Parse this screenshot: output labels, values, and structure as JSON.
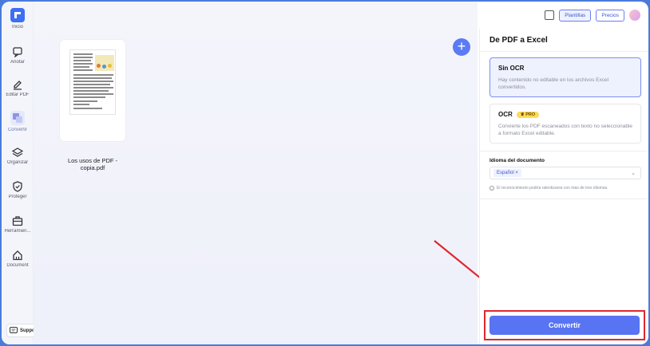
{
  "sidebar": {
    "items": [
      {
        "label": "Inicio",
        "icon": "home-logo-icon"
      },
      {
        "label": "Anotar",
        "icon": "annotate-icon"
      },
      {
        "label": "Editar PDF",
        "icon": "edit-icon"
      },
      {
        "label": "Convertir",
        "icon": "convert-icon",
        "active": true
      },
      {
        "label": "Organizar",
        "icon": "layers-icon"
      },
      {
        "label": "Proteger",
        "icon": "shield-icon"
      },
      {
        "label": "Herramien...",
        "icon": "tools-icon"
      },
      {
        "label": "Document",
        "icon": "house-icon"
      }
    ],
    "support_label": "Support"
  },
  "topbar": {
    "templates_label": "Plantillas",
    "pricing_label": "Precios"
  },
  "file": {
    "name": "Los usos de PDF - copia.pdf"
  },
  "panel": {
    "title": "De PDF a Excel",
    "options": [
      {
        "title": "Sin OCR",
        "desc": "Hay contenido no editable en los archivos Excel convertidos.",
        "selected": true
      },
      {
        "title": "OCR",
        "badge": "PRO",
        "desc": "Convierte los PDF escaneados con texto no seleccionable a formato Excel editable.",
        "selected": false
      }
    ],
    "language_label": "Idioma del documento",
    "language_chip": "Español ×",
    "note": "El reconocimiento podría ralentizarse con más de tres idiomas.",
    "convert_label": "Convertir"
  },
  "colors": {
    "accent": "#5874f2",
    "highlight": "#e0272d",
    "pro_badge": "#fbdb58"
  }
}
